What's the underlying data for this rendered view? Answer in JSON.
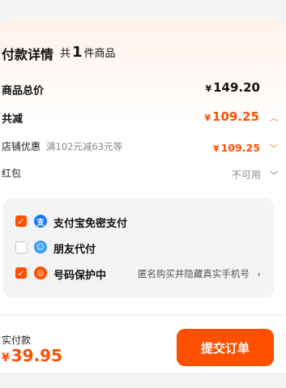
{
  "header": {
    "title": "付款详情",
    "count_prefix": "共",
    "count": "1",
    "count_suffix": "件商品"
  },
  "rows": {
    "total": {
      "label": "商品总价",
      "currency": "¥",
      "amount": "149.20"
    },
    "discount": {
      "label": "共减",
      "currency": "¥",
      "amount": "109.25"
    },
    "shop": {
      "label": "店铺优惠",
      "note": "满102元减63元等",
      "currency": "¥",
      "amount": "109.25"
    },
    "redpacket": {
      "label": "红包",
      "value": "不可用"
    }
  },
  "payment_options": [
    {
      "label": "支付宝免密支付",
      "checked": true,
      "icon": "alipay-icon"
    },
    {
      "label": "朋友代付",
      "checked": false,
      "icon": "friend-pay-icon"
    },
    {
      "label": "号码保护中",
      "checked": true,
      "icon": "shield-icon",
      "desc": "匿名购买并隐藏真实手机号"
    }
  ],
  "footer": {
    "pay_label": "实付款",
    "currency": "¥",
    "amount": "39.95",
    "submit_label": "提交订单"
  },
  "colors": {
    "accent": "#ff5000",
    "price_orange": "#ff4f00",
    "alipay_blue": "#1677ff",
    "friend_blue": "#3a9cf0"
  }
}
